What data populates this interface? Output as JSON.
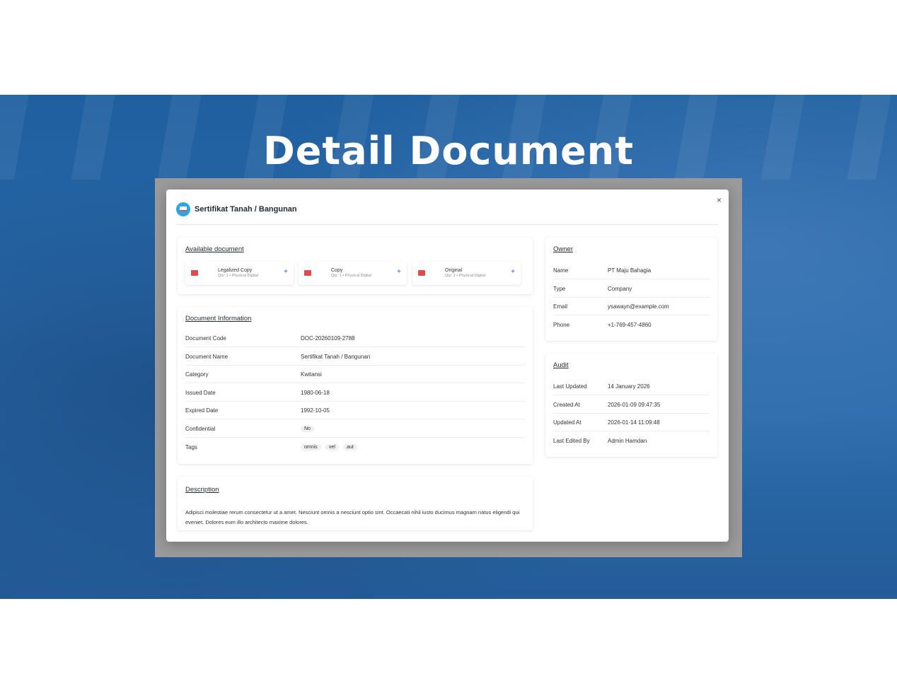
{
  "hero": {
    "title": "Detail Document"
  },
  "modal": {
    "title": "Sertifikat Tanah / Bangunan",
    "close": "×"
  },
  "available": {
    "title": "Available document",
    "items": [
      {
        "name": "Legalized Copy",
        "meta": "Qty: 1 • Physical Digital"
      },
      {
        "name": "Copy",
        "meta": "Qty: 1 • Physical Digital"
      },
      {
        "name": "Original",
        "meta": "Qty: 1 • Physical Digital"
      }
    ],
    "add": "+"
  },
  "info": {
    "title": "Document Information",
    "rows": [
      {
        "label": "Document Code",
        "value": "DOC-20260109-2788"
      },
      {
        "label": "Document Name",
        "value": "Sertifikat Tanah / Bangunan"
      },
      {
        "label": "Category",
        "value": "Kwitansi"
      },
      {
        "label": "Issued Date",
        "value": "1980-06-18"
      },
      {
        "label": "Expired Date",
        "value": "1992-10-05"
      },
      {
        "label": "Confidential",
        "value": "No"
      },
      {
        "label": "Tags",
        "tags": [
          "omnis",
          "vel",
          "aut"
        ]
      }
    ]
  },
  "description": {
    "title": "Description",
    "text": "Adipisci molestiae rerum consectetur ut a amet. Nesciunt omnis a nesciunt optio sint. Occaecati nihil iusto ducimus magnam natus eligendi qui eveniet. Dolores eum illo architecto maxime dolores."
  },
  "owner": {
    "title": "Owner",
    "rows": [
      {
        "label": "Name",
        "value": "PT Maju Bahagia"
      },
      {
        "label": "Type",
        "value": "Company"
      },
      {
        "label": "Email",
        "value": "ysawayn@example.com"
      },
      {
        "label": "Phone",
        "value": "+1-769-457-4860"
      }
    ]
  },
  "audit": {
    "title": "Audit",
    "rows": [
      {
        "label": "Last Updated",
        "value": "14 January 2026"
      },
      {
        "label": "Created At",
        "value": "2026-01-09 09:47:35"
      },
      {
        "label": "Updated At",
        "value": "2026-01-14 11:09:48"
      },
      {
        "label": "Last Edited By",
        "value": "Admin Hamdan"
      }
    ]
  }
}
